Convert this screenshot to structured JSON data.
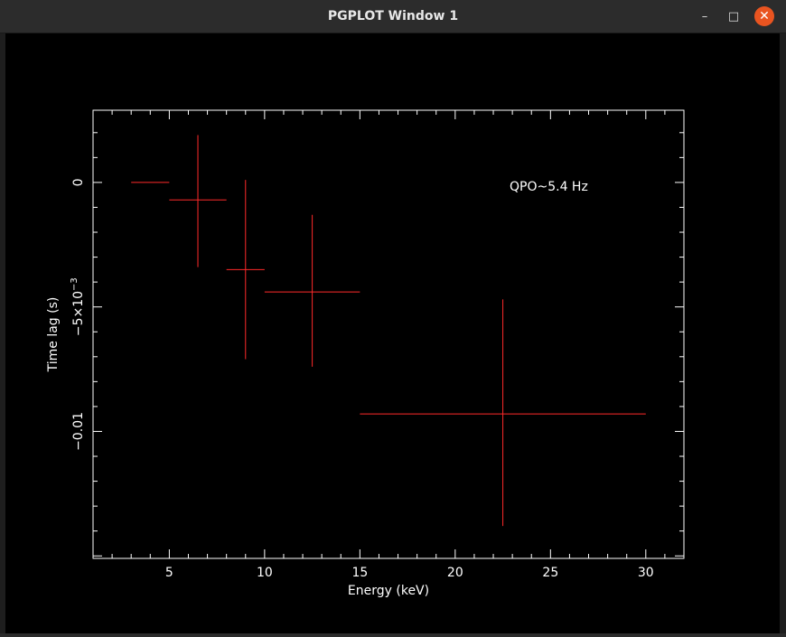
{
  "window": {
    "title": "PGPLOT Window 1",
    "controls": {
      "minimize": "–",
      "maximize": "□",
      "close": "✕"
    }
  },
  "colors": {
    "axes": "#ffffff",
    "data": "#ff2a2a",
    "background": "#000000"
  },
  "chart_data": {
    "type": "scatter",
    "xlabel": "Energy (keV)",
    "ylabel": "Time lag (s)",
    "annotation": "QPO~5.4 Hz",
    "xlim": [
      1,
      32
    ],
    "ylim": [
      -0.0151,
      0.0029
    ],
    "x_ticks": [
      5,
      10,
      15,
      20,
      25,
      30
    ],
    "y_ticks": [
      {
        "value": 0,
        "label": "0"
      },
      {
        "value": -0.005,
        "label": "−5×10",
        "exponent": "−3"
      },
      {
        "value": -0.01,
        "label": "−0.01"
      }
    ],
    "points": [
      {
        "x": 4,
        "xlo": 3,
        "xhi": 5,
        "y": 0.0,
        "ylo": 0.0,
        "yhi": 0.0
      },
      {
        "x": 6.5,
        "xlo": 5,
        "xhi": 8,
        "y": -0.0007,
        "ylo": -0.0034,
        "yhi": 0.0019
      },
      {
        "x": 9,
        "xlo": 8,
        "xhi": 10,
        "y": -0.0035,
        "ylo": -0.0071,
        "yhi": 0.0001
      },
      {
        "x": 12.5,
        "xlo": 10,
        "xhi": 15,
        "y": -0.0044,
        "ylo": -0.0074,
        "yhi": -0.0013
      },
      {
        "x": 22.5,
        "xlo": 15,
        "xhi": 30,
        "y": -0.0093,
        "ylo": -0.0138,
        "yhi": -0.0047
      }
    ]
  }
}
